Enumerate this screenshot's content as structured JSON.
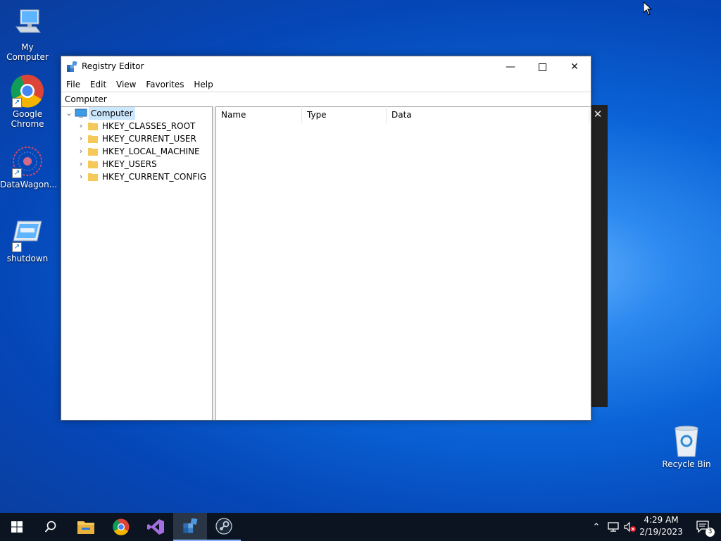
{
  "desktop": {
    "icons": [
      {
        "label": "My Computer"
      },
      {
        "label": "Google Chrome"
      },
      {
        "label": "DataWagon..."
      },
      {
        "label": "shutdown"
      },
      {
        "label": "Recycle Bin"
      }
    ]
  },
  "window": {
    "title": "Registry Editor",
    "menu": [
      "File",
      "Edit",
      "View",
      "Favorites",
      "Help"
    ],
    "address": "Computer",
    "tree": {
      "root": "Computer",
      "children": [
        "HKEY_CLASSES_ROOT",
        "HKEY_CURRENT_USER",
        "HKEY_LOCAL_MACHINE",
        "HKEY_USERS",
        "HKEY_CURRENT_CONFIG"
      ]
    },
    "columns": [
      "Name",
      "Type",
      "Data"
    ]
  },
  "taskbar": {
    "time": "4:29 AM",
    "date": "2/19/2023",
    "notification_count": "3"
  },
  "colors": {
    "taskbar": "#0b1420",
    "selection": "#cce8ff",
    "folder": "#f5c85a"
  }
}
